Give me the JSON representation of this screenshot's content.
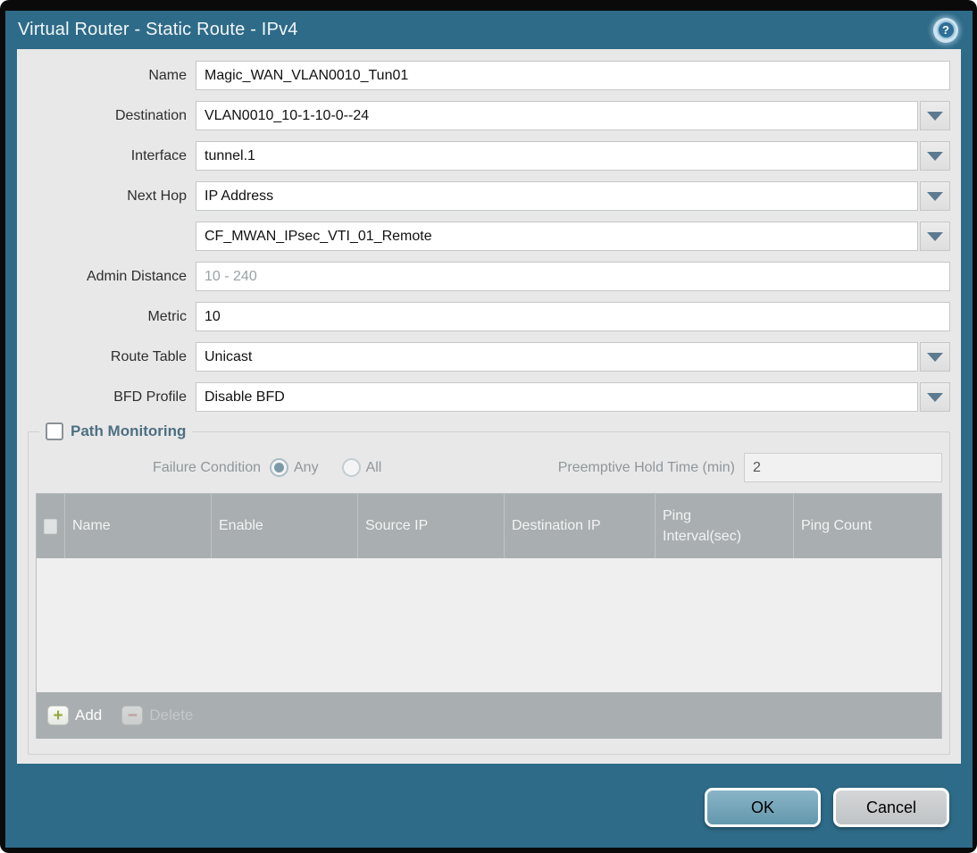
{
  "title_bar": {
    "title": "Virtual Router - Static Route - IPv4",
    "help_glyph": "?"
  },
  "form": {
    "name": {
      "label": "Name",
      "value": "Magic_WAN_VLAN0010_Tun01"
    },
    "destination": {
      "label": "Destination",
      "value": "VLAN0010_10-1-10-0--24"
    },
    "interface": {
      "label": "Interface",
      "value": "tunnel.1"
    },
    "next_hop": {
      "label": "Next Hop",
      "value": "IP Address"
    },
    "next_hop_address": {
      "value": "CF_MWAN_IPsec_VTI_01_Remote"
    },
    "admin_distance": {
      "label": "Admin Distance",
      "placeholder": "10 - 240",
      "value": ""
    },
    "metric": {
      "label": "Metric",
      "value": "10"
    },
    "route_table": {
      "label": "Route Table",
      "value": "Unicast"
    },
    "bfd_profile": {
      "label": "BFD Profile",
      "value": "Disable BFD"
    }
  },
  "path_monitoring": {
    "title": "Path Monitoring",
    "enabled": false,
    "failure_condition": {
      "label": "Failure Condition",
      "options": [
        {
          "label": "Any",
          "selected": true
        },
        {
          "label": "All",
          "selected": false
        }
      ]
    },
    "preemptive_hold_time": {
      "label": "Preemptive Hold Time (min)",
      "value": "2"
    },
    "table": {
      "columns": [
        "Name",
        "Enable",
        "Source IP",
        "Destination IP",
        "Ping Interval(sec)",
        "Ping Count"
      ],
      "rows": []
    },
    "toolbar": {
      "add_label": "Add",
      "delete_label": "Delete",
      "add_glyph": "+",
      "delete_glyph": "−"
    }
  },
  "footer": {
    "ok_label": "OK",
    "cancel_label": "Cancel"
  },
  "colors": {
    "titlebar_teal": "#2e6b88",
    "table_header_gray": "#a9aeb0",
    "ok_button": "#6fa2b7",
    "add_green": "#8fa83e",
    "delete_red": "#cf8d8d"
  }
}
